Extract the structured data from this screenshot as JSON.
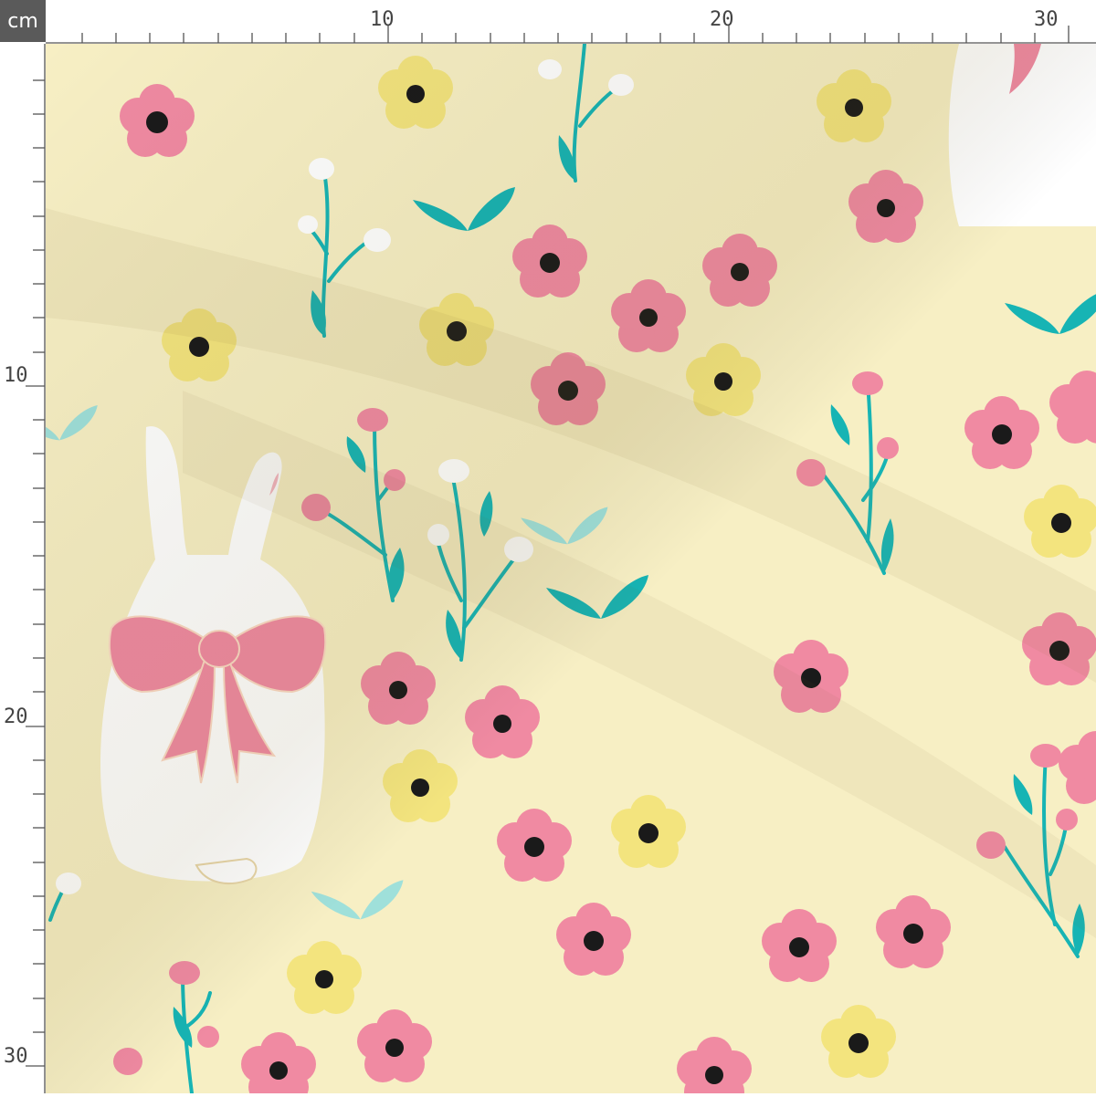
{
  "ruler": {
    "unit": "cm",
    "top_labels": [
      "10",
      "20",
      "30"
    ],
    "left_labels": [
      "10",
      "20",
      "30"
    ]
  },
  "palette": {
    "background": "#f7efc4",
    "pink": "#f08aa2",
    "yellow": "#f3e47e",
    "teal": "#17b4b4",
    "mint": "#9fe0da",
    "white": "#ffffff",
    "center": "#1a1a1a"
  },
  "icons": [
    "bunny-icon",
    "bow-icon",
    "flower-icon",
    "sprig-icon",
    "leaf-icon"
  ]
}
